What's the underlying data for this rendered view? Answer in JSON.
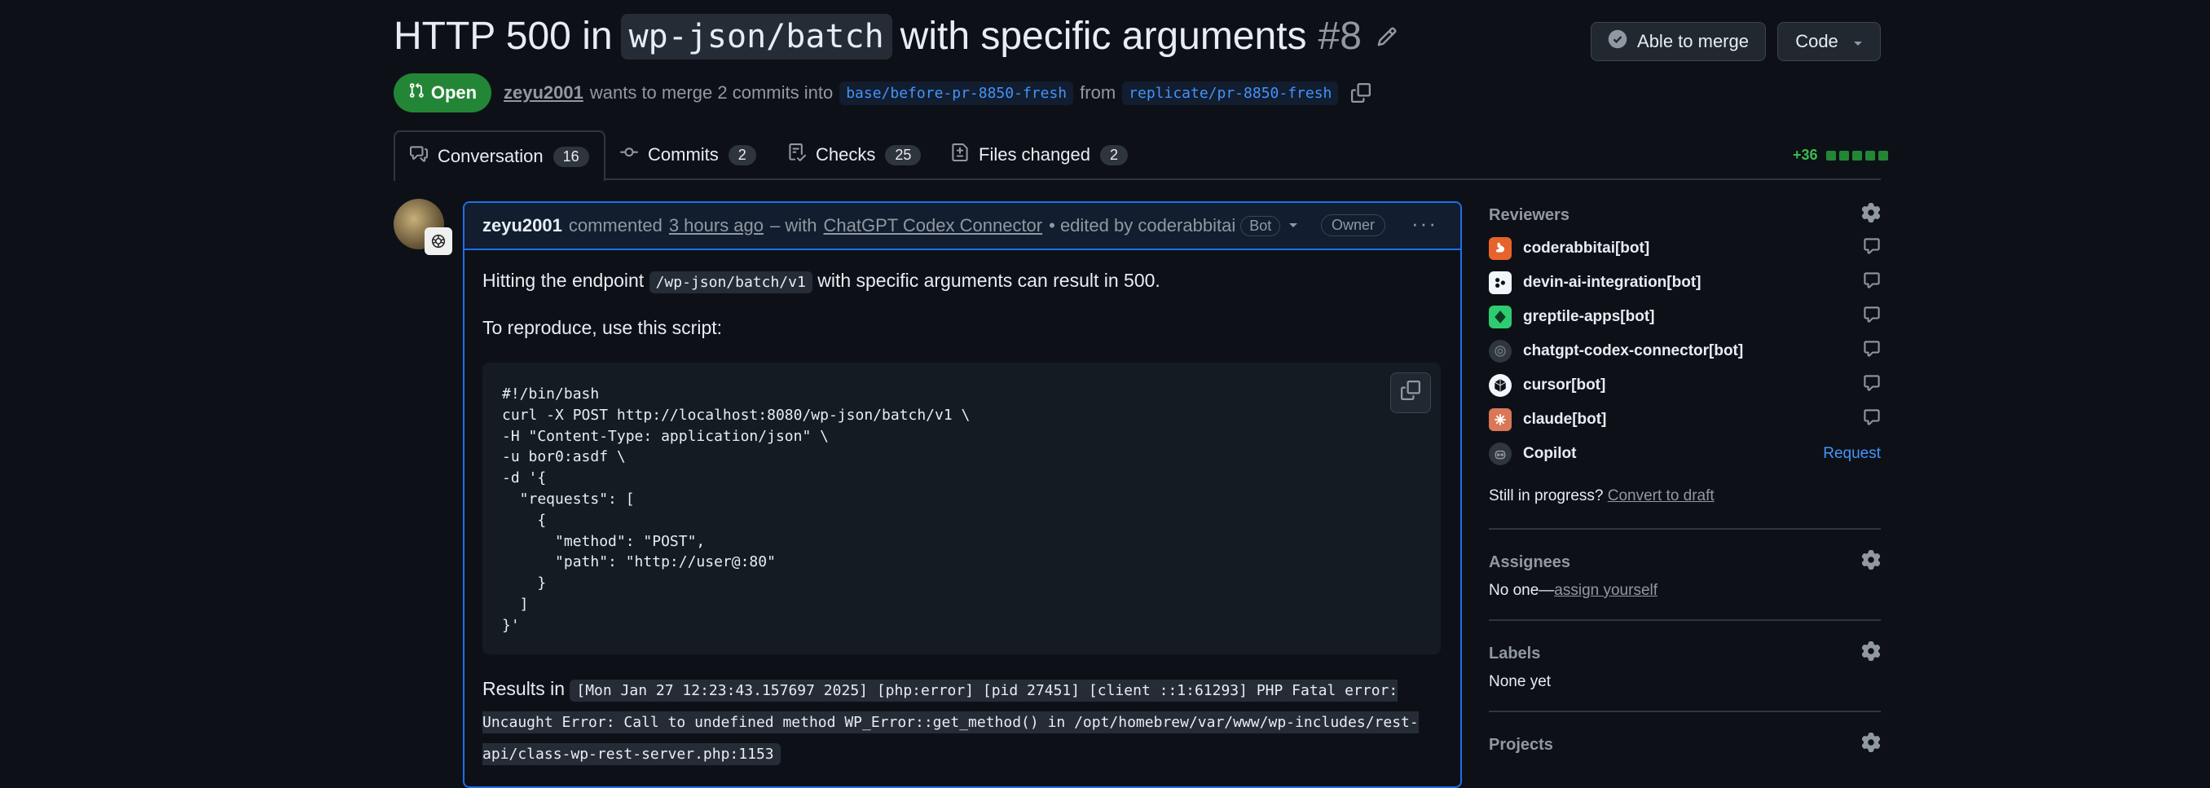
{
  "pr": {
    "title_prefix": "HTTP 500 in",
    "title_code": "wp-json/batch",
    "title_suffix": "with specific arguments",
    "number": "#8",
    "state": "Open",
    "merge_button": "Able to merge",
    "code_button": "Code",
    "author": "zeyu2001",
    "meta_text": "wants to merge 2 commits into",
    "base_branch": "base/before-pr-8850-fresh",
    "from_text": "from",
    "head_branch": "replicate/pr-8850-fresh"
  },
  "tabs": [
    {
      "label": "Conversation",
      "count": "16"
    },
    {
      "label": "Commits",
      "count": "2"
    },
    {
      "label": "Checks",
      "count": "25"
    },
    {
      "label": "Files changed",
      "count": "2"
    }
  ],
  "diffstat": {
    "additions": "+36"
  },
  "comment": {
    "author": "zeyu2001",
    "action": "commented",
    "time": "3 hours ago",
    "with_text": "– with",
    "app": "ChatGPT Codex Connector",
    "edited_text": "• edited by coderabbitai",
    "bot_label": "Bot",
    "owner_label": "Owner",
    "p1_before": "Hitting the endpoint",
    "p1_code": "/wp-json/batch/v1",
    "p1_after": "with specific arguments can result in 500.",
    "p2": "To reproduce, use this script:",
    "code": "#!/bin/bash\ncurl -X POST http://localhost:8080/wp-json/batch/v1 \\\n-H \"Content-Type: application/json\" \\\n-u bor0:asdf \\\n-d '{\n  \"requests\": [\n    {\n      \"method\": \"POST\",\n      \"path\": \"http://user@:80\"\n    }\n  ]\n}'",
    "p3_before": "Results in",
    "p3_code": "[Mon Jan 27 12:23:43.157697 2025] [php:error] [pid 27451] [client ::1:61293] PHP Fatal error: Uncaught Error: Call to undefined method WP_Error::get_method() in /opt/homebrew/var/www/wp-includes/rest-api/class-wp-rest-server.php:1153"
  },
  "sidebar": {
    "reviewers_title": "Reviewers",
    "reviewers": [
      {
        "name": "coderabbitai[bot]",
        "color": "#e8632b",
        "icon": "rabbit-icon"
      },
      {
        "name": "devin-ai-integration[bot]",
        "color": "#f0f6fc",
        "icon": "devin-icon"
      },
      {
        "name": "greptile-apps[bot]",
        "color": "#2ecc71",
        "icon": "greptile-icon"
      },
      {
        "name": "chatgpt-codex-connector[bot]",
        "color": "#30363d",
        "icon": "openai-icon"
      },
      {
        "name": "cursor[bot]",
        "color": "#f0f6fc",
        "icon": "cursor-icon"
      },
      {
        "name": "claude[bot]",
        "color": "#d97757",
        "icon": "claude-icon"
      },
      {
        "name": "Copilot",
        "color": "#30363d",
        "icon": "copilot-icon",
        "action": "Request"
      }
    ],
    "progress_text": "Still in progress?",
    "progress_link": "Convert to draft",
    "assignees_title": "Assignees",
    "assignees_none": "No one—",
    "assignees_link": "assign yourself",
    "labels_title": "Labels",
    "labels_none": "None yet",
    "projects_title": "Projects"
  }
}
